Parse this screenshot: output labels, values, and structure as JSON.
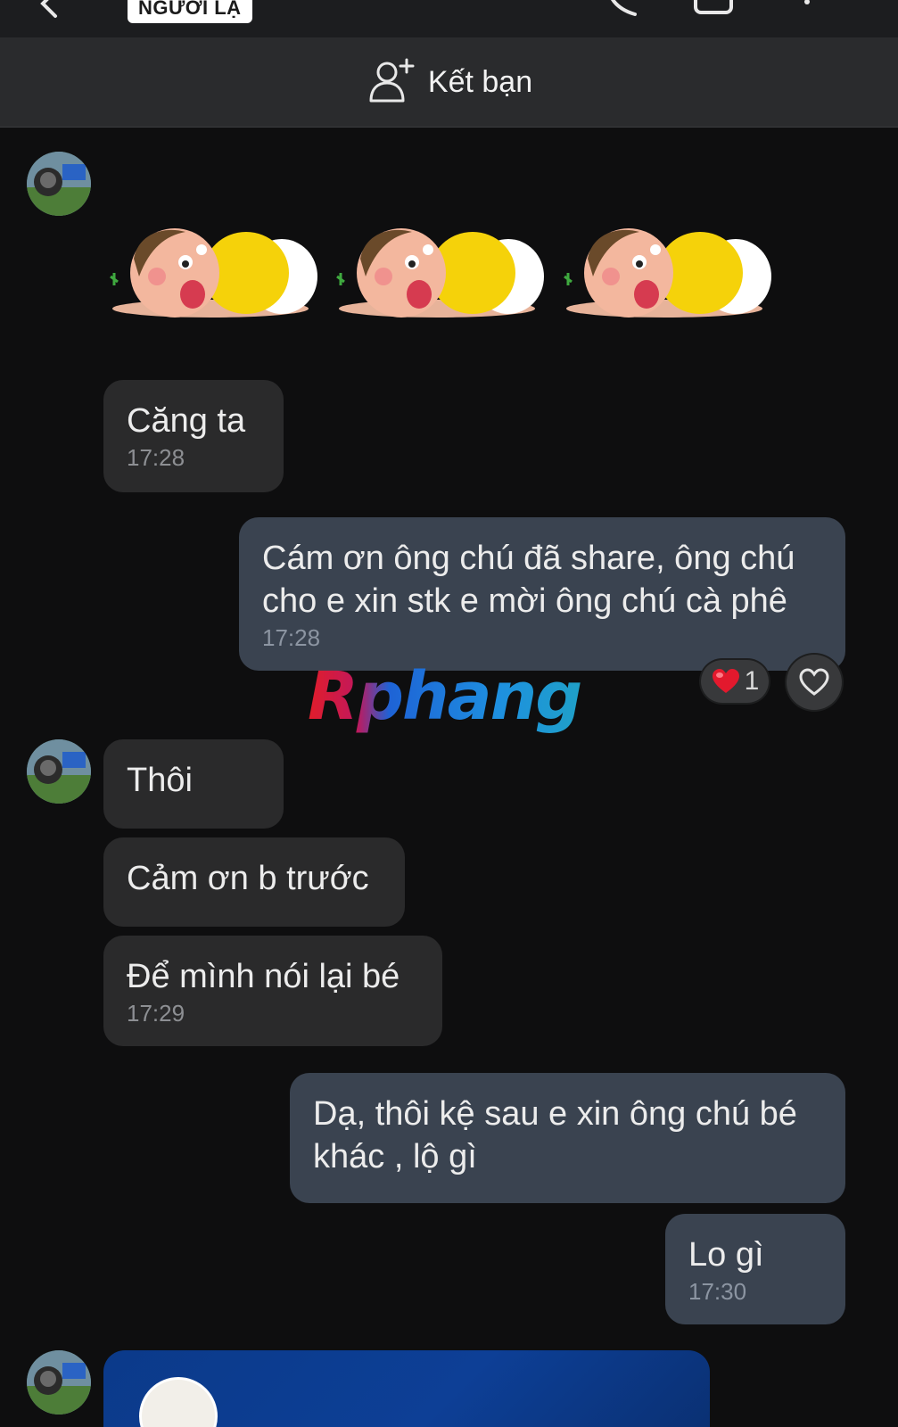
{
  "header": {
    "stranger_badge": "NGƯỜI LẠ"
  },
  "friend_bar": {
    "label": "Kết bạn",
    "icon": "add-friend-icon"
  },
  "messages": [
    {
      "side": "received",
      "text": "Căng ta",
      "time": "17:28"
    },
    {
      "side": "sent",
      "text": "Cám ơn ông chú đã share, ông chú\ncho e xin stk e mời ông chú cà phê",
      "time": "17:28"
    },
    {
      "side": "received",
      "text": "Thôi",
      "time": ""
    },
    {
      "side": "received",
      "text": "Cảm ơn b trước",
      "time": ""
    },
    {
      "side": "received",
      "text": "Để mình nói lại bé",
      "time": "17:29"
    },
    {
      "side": "sent",
      "text": "Dạ, thôi kệ sau e xin ông chú bé\nkhác , lộ gì",
      "time": ""
    },
    {
      "side": "sent",
      "text": "Lo gì",
      "time": "17:30"
    }
  ],
  "reaction": {
    "count": "1",
    "icon": "heart-icon"
  },
  "watermark": "Rphang",
  "colors": {
    "background": "#0e0e0f",
    "received_bubble": "#2a2a2b",
    "sent_bubble": "#3a4350",
    "card": "#0d3f96"
  }
}
